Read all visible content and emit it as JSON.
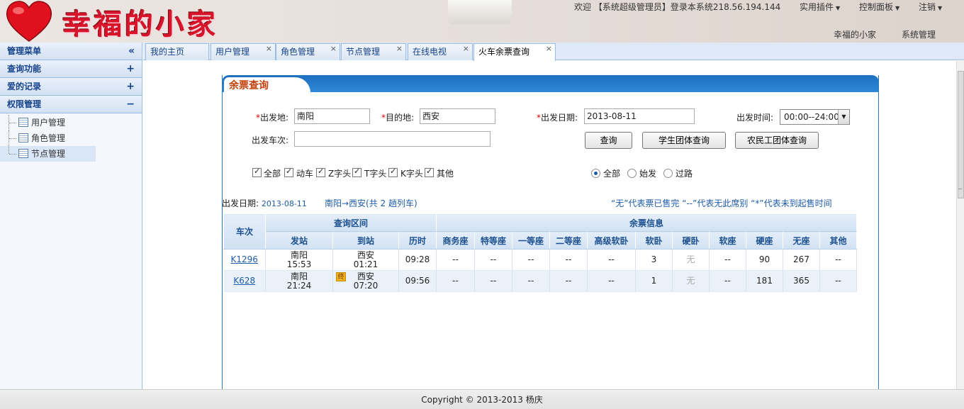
{
  "header": {
    "logo_text": "幸福的小家",
    "welcome": "欢迎 【系统超级管理员】登录本系统218.56.194.144",
    "menus": [
      "实用插件",
      "控制面板",
      "注销"
    ],
    "links": [
      "幸福的小家",
      "系统管理"
    ]
  },
  "sidebar": {
    "sections": [
      {
        "label": "管理菜单",
        "toggle": "«"
      },
      {
        "label": "查询功能",
        "toggle": "+"
      },
      {
        "label": "爱的记录",
        "toggle": "+"
      },
      {
        "label": "权限管理",
        "toggle": "−"
      }
    ],
    "items": [
      {
        "label": "用户管理"
      },
      {
        "label": "角色管理"
      },
      {
        "label": "节点管理"
      }
    ]
  },
  "tabs": [
    {
      "label": "我的主页"
    },
    {
      "label": "用户管理",
      "close": "×"
    },
    {
      "label": "角色管理",
      "close": "×"
    },
    {
      "label": "节点管理",
      "close": "×"
    },
    {
      "label": "在线电视",
      "close": "×"
    },
    {
      "label": "火车余票查询",
      "close": "×"
    }
  ],
  "panel": {
    "title": "余票查询"
  },
  "form": {
    "from_label": "出发地:",
    "from_value": "南阳",
    "to_label": "目的地:",
    "to_value": "西安",
    "date_label": "出发日期:",
    "date_value": "2013-08-11",
    "time_label": "出发时间:",
    "time_value": "00:00--24:00",
    "train_label": "出发车次:",
    "train_value": "",
    "required_mark": "*",
    "buttons": [
      "查询",
      "学生团体查询",
      "农民工团体查询"
    ],
    "train_types": [
      "全部",
      "动车",
      "Z字头",
      "T字头",
      "K字头",
      "其他"
    ],
    "station_types": [
      "全部",
      "始发",
      "过路"
    ],
    "station_selected": "全部"
  },
  "summary": {
    "date_label": "出发日期:",
    "date_value": "2013-08-11",
    "route": "南阳→西安(共 2 趟列车)",
    "legend": "“无”代表票已售完  “--”代表无此席别  “*”代表未到起售时间"
  },
  "table": {
    "group_headers": {
      "train": "车次",
      "interval": "查询区间",
      "tickets": "余票信息"
    },
    "sub_headers": [
      "发站",
      "到站",
      "历时",
      "商务座",
      "特等座",
      "一等座",
      "二等座",
      "高级软卧",
      "软卧",
      "硬卧",
      "软座",
      "硬座",
      "无座",
      "其他"
    ],
    "rows": [
      {
        "train": "K1296",
        "from": "南阳",
        "dep": "15:53",
        "to": "西安",
        "arr": "01:21",
        "tag": "",
        "duration": "09:28",
        "seats": [
          "--",
          "--",
          "--",
          "--",
          "--",
          "3",
          "无",
          "--",
          "90",
          "267",
          "--"
        ]
      },
      {
        "train": "K628",
        "from": "南阳",
        "dep": "21:24",
        "to": "西安",
        "arr": "07:20",
        "tag": "终",
        "duration": "09:56",
        "seats": [
          "--",
          "--",
          "--",
          "--",
          "--",
          "1",
          "无",
          "--",
          "181",
          "365",
          "--"
        ]
      }
    ]
  },
  "footer": {
    "copyright": "Copyright © 2013-2013 杨庆"
  }
}
